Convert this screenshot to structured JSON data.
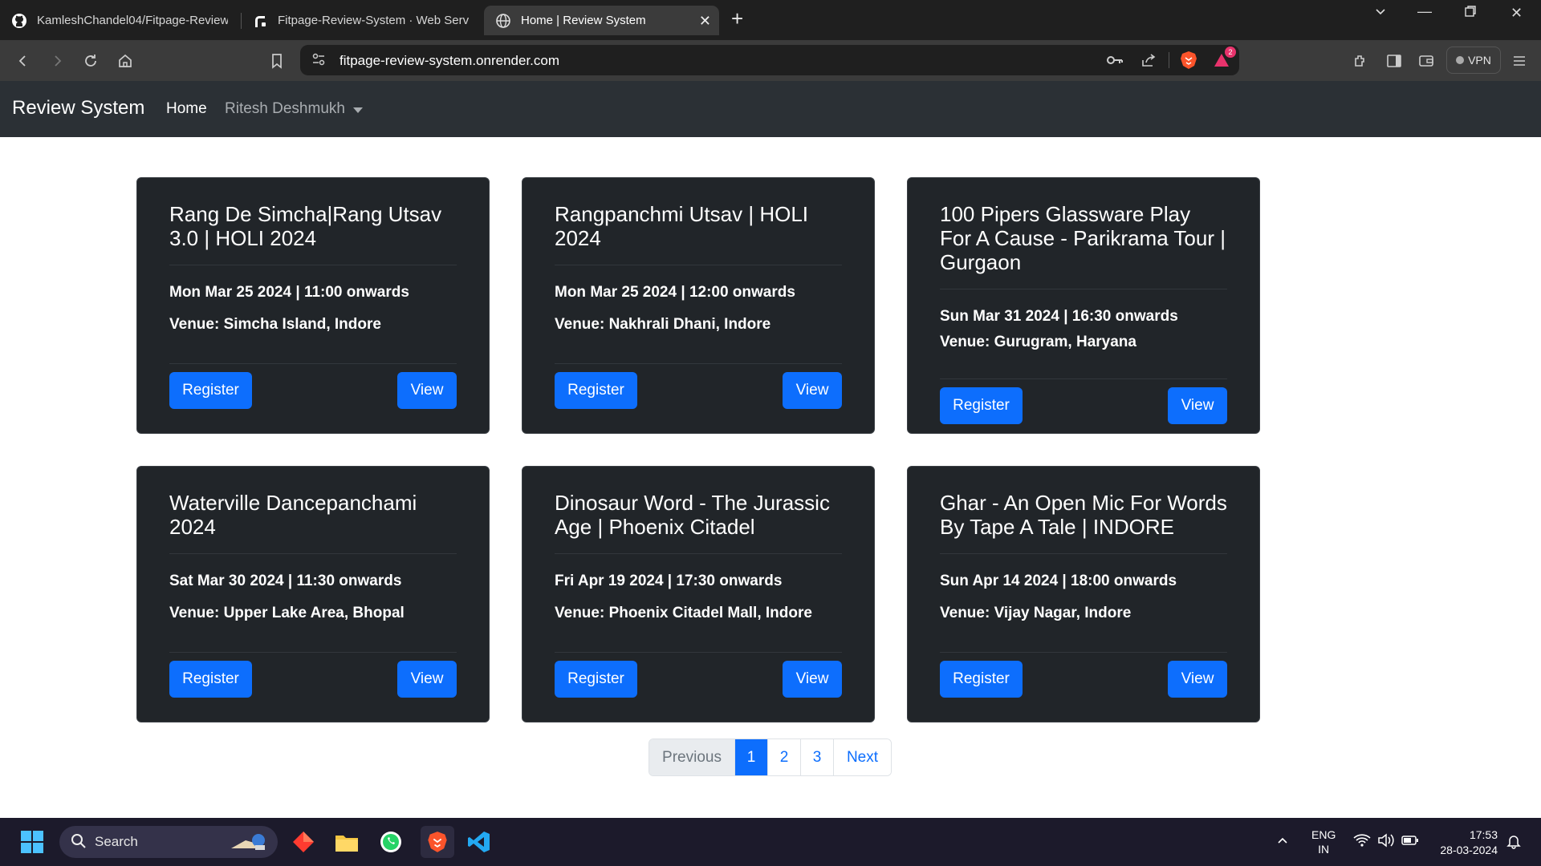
{
  "browser": {
    "tabs": [
      {
        "title": "KamleshChandel04/Fitpage-Review-S",
        "favicon": "github-icon"
      },
      {
        "title": "Fitpage-Review-System · Web Servic",
        "favicon": "render-icon"
      },
      {
        "title": "Home | Review System",
        "favicon": "globe-icon"
      }
    ],
    "url": "fitpage-review-system.onrender.com",
    "vpn_label": "VPN",
    "notification_count": "2"
  },
  "navbar": {
    "brand": "Review System",
    "home": "Home",
    "user": "Ritesh Deshmukh"
  },
  "events": [
    {
      "title": "Rang De Simcha|Rang Utsav 3.0 | HOLI 2024",
      "date": "Mon Mar 25 2024 | 11:00 onwards",
      "venue": "Venue: Simcha Island, Indore"
    },
    {
      "title": "Rangpanchmi Utsav | HOLI 2024",
      "date": "Mon Mar 25 2024 | 12:00 onwards",
      "venue": "Venue: Nakhrali Dhani, Indore"
    },
    {
      "title": "100 Pipers Glassware Play For A Cause - Parikrama Tour | Gurgaon",
      "date": "Sun Mar 31 2024 | 16:30 onwards",
      "venue": "Venue: Gurugram, Haryana"
    },
    {
      "title": "Waterville Dancepanchami 2024",
      "date": "Sat Mar 30 2024 | 11:30 onwards",
      "venue": "Venue: Upper Lake Area, Bhopal"
    },
    {
      "title": "Dinosaur Word - The Jurassic Age | Phoenix Citadel",
      "date": "Fri Apr 19 2024 | 17:30 onwards",
      "venue": "Venue: Phoenix Citadel Mall, Indore"
    },
    {
      "title": "Ghar - An Open Mic For Words By Tape A Tale | INDORE",
      "date": "Sun Apr 14 2024 | 18:00 onwards",
      "venue": "Venue: Vijay Nagar, Indore"
    }
  ],
  "buttons": {
    "register": "Register",
    "view": "View"
  },
  "pagination": {
    "previous": "Previous",
    "pages": [
      "1",
      "2",
      "3"
    ],
    "active_page": "1",
    "next": "Next"
  },
  "taskbar": {
    "search": "Search",
    "lang_line1": "ENG",
    "lang_line2": "IN",
    "time": "17:53",
    "date": "28-03-2024"
  },
  "colors": {
    "primary": "#0d6efd",
    "card_bg": "#212529",
    "navbar_bg": "#2b3035"
  }
}
